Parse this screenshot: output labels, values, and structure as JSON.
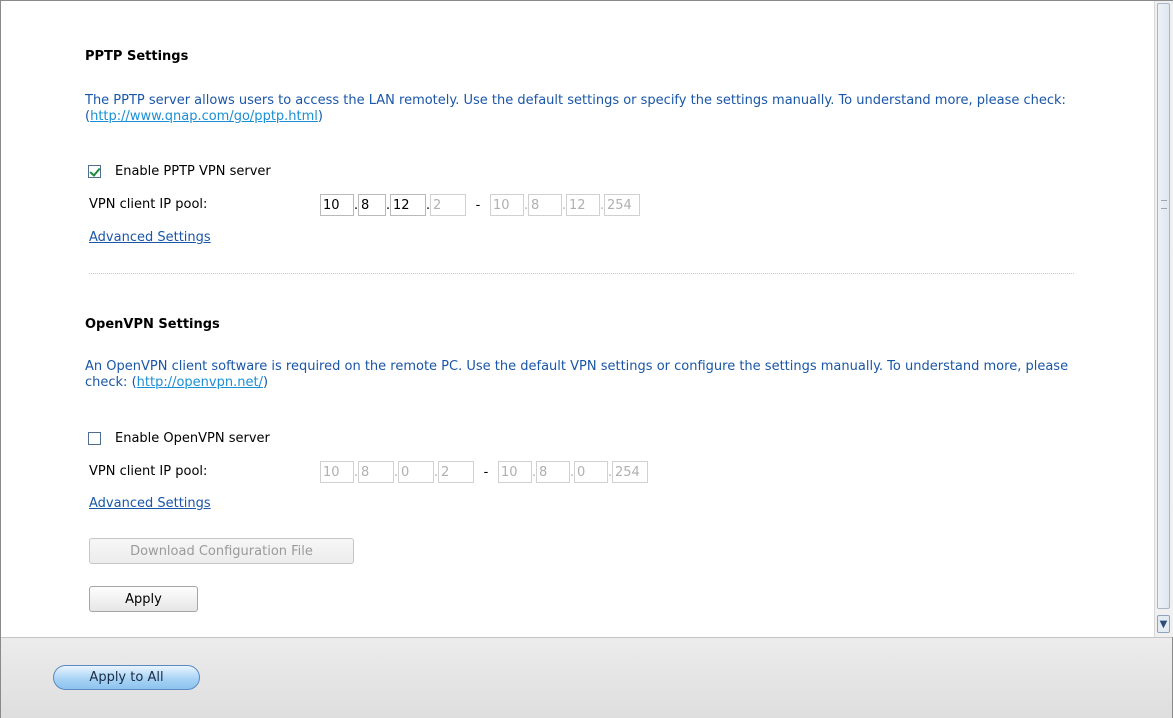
{
  "pptp": {
    "title": "PPTP Settings",
    "desc_text": "The PPTP server allows users to access the LAN remotely. Use the default settings or specify the settings manually. To understand more, please check: (",
    "desc_link": "http://www.qnap.com/go/pptp.html",
    "desc_end": ")",
    "enable_label": "Enable PPTP VPN server",
    "enable_checked": true,
    "pool_label": "VPN client IP pool:",
    "pool_start": [
      "10",
      "8",
      "12",
      "2"
    ],
    "pool_end": [
      "10",
      "8",
      "12",
      "254"
    ],
    "advanced_label": "Advanced Settings"
  },
  "openvpn": {
    "title": "OpenVPN Settings",
    "desc_text": "An OpenVPN client software is required on the remote PC. Use the default VPN settings or configure the settings manually. To understand more, please check: (",
    "desc_link": "http://openvpn.net/",
    "desc_end": ")",
    "enable_label": "Enable OpenVPN server",
    "enable_checked": false,
    "pool_label": "VPN client IP pool:",
    "pool_start": [
      "10",
      "8",
      "0",
      "2"
    ],
    "pool_end": [
      "10",
      "8",
      "0",
      "254"
    ],
    "advanced_label": "Advanced Settings",
    "download_label": "Download Configuration File"
  },
  "apply_label": "Apply",
  "footer": {
    "apply_all_label": "Apply to All"
  },
  "scrollbar": {
    "down_arrow": "chevron-down-icon"
  },
  "colors": {
    "link": "#1a8fd6",
    "desc": "#1a56a8",
    "apply_all": "#a9d3f5"
  }
}
